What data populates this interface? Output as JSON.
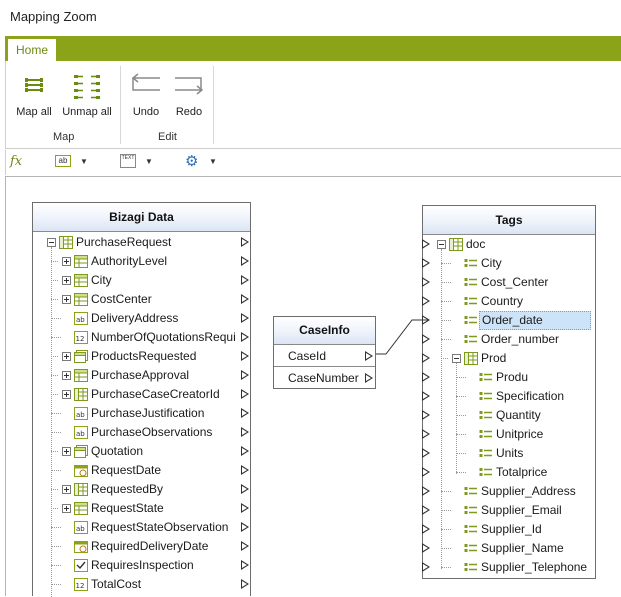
{
  "window": {
    "title": "Mapping Zoom"
  },
  "ribbon": {
    "tabs": [
      {
        "label": "Home"
      }
    ],
    "groups": [
      {
        "label": "Map",
        "buttons": [
          {
            "label": "Map all",
            "icon": "map-all-icon"
          },
          {
            "label": "Unmap all",
            "icon": "unmap-all-icon"
          }
        ]
      },
      {
        "label": "Edit",
        "buttons": [
          {
            "label": "Undo",
            "icon": "undo-icon"
          },
          {
            "label": "Redo",
            "icon": "redo-icon"
          }
        ]
      }
    ]
  },
  "toolbar": {
    "items": [
      {
        "icon": "function-icon",
        "label": "fx"
      },
      {
        "icon": "text-field-icon",
        "label": "ab"
      },
      {
        "icon": "text-function-icon",
        "label": "TEXT"
      },
      {
        "icon": "gear-icon"
      }
    ]
  },
  "bizagi_panel": {
    "title": "Bizagi Data",
    "items": [
      {
        "label": "PurchaseRequest",
        "level": 0,
        "icon": "entity-icon",
        "expander": "minus"
      },
      {
        "label": "AuthorityLevel",
        "level": 1,
        "icon": "table-icon",
        "expander": "plus"
      },
      {
        "label": "City",
        "level": 1,
        "icon": "table-icon",
        "expander": "plus"
      },
      {
        "label": "CostCenter",
        "level": 1,
        "icon": "table-icon",
        "expander": "plus"
      },
      {
        "label": "DeliveryAddress",
        "level": 1,
        "icon": "text-icon",
        "expander": ""
      },
      {
        "label": "NumberOfQuotationsRequir",
        "level": 1,
        "icon": "number-icon",
        "expander": ""
      },
      {
        "label": "ProductsRequested",
        "level": 1,
        "icon": "collection-icon",
        "expander": "plus"
      },
      {
        "label": "PurchaseApproval",
        "level": 1,
        "icon": "table-icon",
        "expander": "plus"
      },
      {
        "label": "PurchaseCaseCreatorId",
        "level": 1,
        "icon": "entity-icon",
        "expander": "plus"
      },
      {
        "label": "PurchaseJustification",
        "level": 1,
        "icon": "text-icon",
        "expander": ""
      },
      {
        "label": "PurchaseObservations",
        "level": 1,
        "icon": "text-icon",
        "expander": ""
      },
      {
        "label": "Quotation",
        "level": 1,
        "icon": "collection-icon",
        "expander": "plus"
      },
      {
        "label": "RequestDate",
        "level": 1,
        "icon": "date-icon",
        "expander": ""
      },
      {
        "label": "RequestedBy",
        "level": 1,
        "icon": "entity-icon",
        "expander": "plus"
      },
      {
        "label": "RequestState",
        "level": 1,
        "icon": "table-icon",
        "expander": "plus"
      },
      {
        "label": "RequestStateObservation",
        "level": 1,
        "icon": "text-icon",
        "expander": ""
      },
      {
        "label": "RequiredDeliveryDate",
        "level": 1,
        "icon": "date-icon",
        "expander": ""
      },
      {
        "label": "RequiresInspection",
        "level": 1,
        "icon": "checkbox-icon",
        "expander": ""
      },
      {
        "label": "TotalCost",
        "level": 1,
        "icon": "number-icon",
        "expander": ""
      }
    ]
  },
  "caseinfo_panel": {
    "title": "CaseInfo",
    "items": [
      {
        "label": "CaseId"
      },
      {
        "label": "CaseNumber"
      }
    ]
  },
  "tags_panel": {
    "title": "Tags",
    "items": [
      {
        "label": "doc",
        "level": 0,
        "icon": "entity-icon",
        "expander": "minus"
      },
      {
        "label": "City",
        "level": 1,
        "icon": "tag-icon",
        "expander": ""
      },
      {
        "label": "Cost_Center",
        "level": 1,
        "icon": "tag-icon",
        "expander": ""
      },
      {
        "label": "Country",
        "level": 1,
        "icon": "tag-icon",
        "expander": ""
      },
      {
        "label": "Order_date",
        "level": 1,
        "icon": "tag-icon",
        "expander": "",
        "selected": true
      },
      {
        "label": "Order_number",
        "level": 1,
        "icon": "tag-icon",
        "expander": ""
      },
      {
        "label": "Prod",
        "level": 1,
        "icon": "entity-icon",
        "expander": "minus"
      },
      {
        "label": "Produ",
        "level": 2,
        "icon": "tag-icon",
        "expander": ""
      },
      {
        "label": "Specification",
        "level": 2,
        "icon": "tag-icon",
        "expander": ""
      },
      {
        "label": "Quantity",
        "level": 2,
        "icon": "tag-icon",
        "expander": ""
      },
      {
        "label": "Unitprice",
        "level": 2,
        "icon": "tag-icon",
        "expander": ""
      },
      {
        "label": "Units",
        "level": 2,
        "icon": "tag-icon",
        "expander": ""
      },
      {
        "label": "Totalprice",
        "level": 2,
        "icon": "tag-icon",
        "expander": ""
      },
      {
        "label": "Supplier_Address",
        "level": 1,
        "icon": "tag-icon",
        "expander": ""
      },
      {
        "label": "Supplier_Email",
        "level": 1,
        "icon": "tag-icon",
        "expander": ""
      },
      {
        "label": "Supplier_Id",
        "level": 1,
        "icon": "tag-icon",
        "expander": ""
      },
      {
        "label": "Supplier_Name",
        "level": 1,
        "icon": "tag-icon",
        "expander": ""
      },
      {
        "label": "Supplier_Telephone",
        "level": 1,
        "icon": "tag-icon",
        "expander": ""
      }
    ]
  },
  "mappings": [
    {
      "from": "CaseInfo.CaseId",
      "to": "Tags.Order_date"
    }
  ],
  "colors": {
    "accent": "#8aa318",
    "selection": "#cde3f8",
    "tab_text": "#6b8a10"
  }
}
